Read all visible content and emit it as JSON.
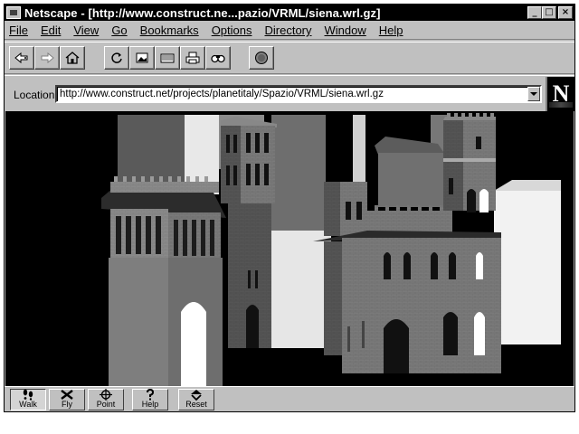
{
  "window": {
    "title": "Netscape - [http://www.construct.ne...pazio/VRML/siena.wrl.gz]",
    "controls": {
      "minimize": "_",
      "maximize": "□",
      "close": "×"
    }
  },
  "menu": [
    {
      "label": "File"
    },
    {
      "label": "Edit"
    },
    {
      "label": "View"
    },
    {
      "label": "Go"
    },
    {
      "label": "Bookmarks"
    },
    {
      "label": "Options"
    },
    {
      "label": "Directory"
    },
    {
      "label": "Window"
    },
    {
      "label": "Help"
    }
  ],
  "toolbar": {
    "icons": [
      "back-icon",
      "forward-icon",
      "home-icon",
      "reload-icon",
      "images-icon",
      "open-icon",
      "print-icon",
      "find-icon",
      "stop-icon"
    ]
  },
  "location": {
    "label": "Location:",
    "url": "http://www.construct.net/projects/planetitaly/Spazio/VRML/siena.wrl.gz"
  },
  "logo": {
    "letter": "N"
  },
  "vrml_nav": [
    {
      "label": "Walk",
      "icon": "walk-icon",
      "active": true
    },
    {
      "label": "Fly",
      "icon": "fly-icon",
      "active": false
    },
    {
      "label": "Point",
      "icon": "point-icon",
      "active": false
    },
    {
      "label": "Help",
      "icon": "help-icon",
      "active": false
    },
    {
      "label": "Reset",
      "icon": "reset-icon",
      "active": false
    }
  ],
  "colors": {
    "window_chrome": "#c0c0c0",
    "title_bar": "#000000",
    "scene_background": "#000000"
  }
}
